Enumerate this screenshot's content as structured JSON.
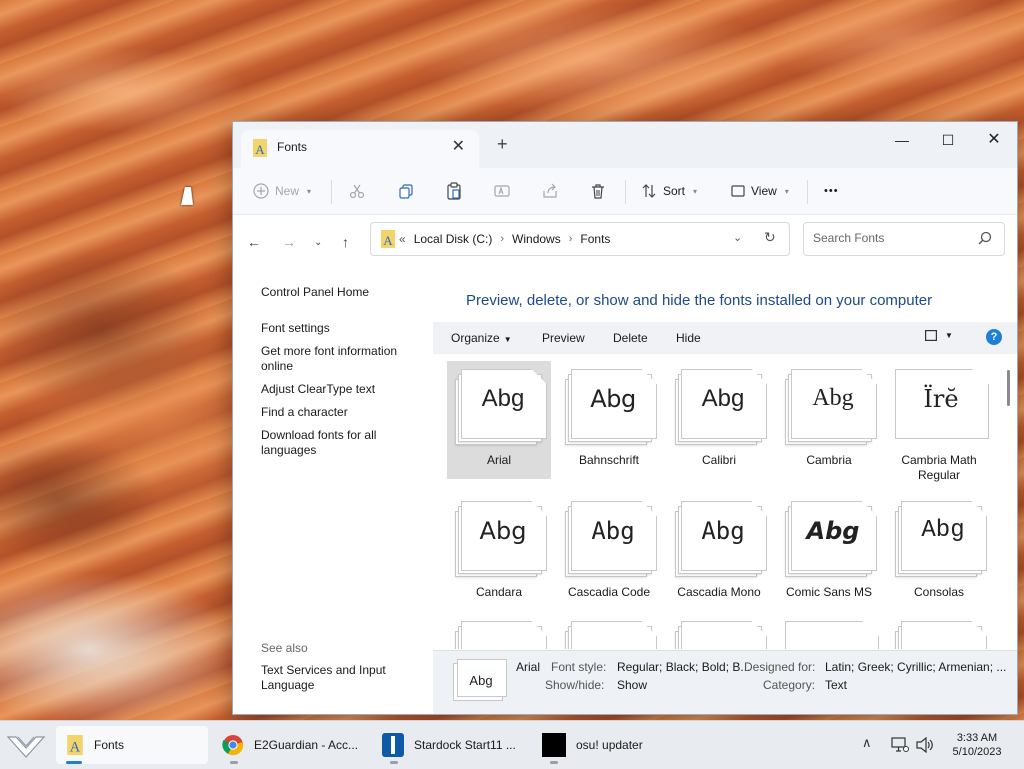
{
  "window": {
    "tab_title": "Fonts",
    "min_glyph": "—",
    "max_glyph": "☐",
    "close_glyph": "✕",
    "tab_close_glyph": "✕",
    "new_tab_glyph": "+"
  },
  "commandbar": {
    "new_label": "New",
    "sort_label": "Sort",
    "view_label": "View",
    "more_glyph": "•••"
  },
  "address": {
    "overflow": "«",
    "crumbs": [
      "Local Disk (C:)",
      "Windows",
      "Fonts"
    ],
    "sep": "›",
    "search_placeholder": "Search Fonts"
  },
  "leftpane": {
    "links": [
      "Control Panel Home",
      "Font settings",
      "Get more font information online",
      "Adjust ClearType text",
      "Find a character",
      "Download fonts for all languages"
    ],
    "see_also_label": "See also",
    "see_also_links": [
      "Text Services and Input Language"
    ]
  },
  "main": {
    "title": "Preview, delete, or show and hide the fonts installed on your computer",
    "toolbar": {
      "organize": "Organize",
      "preview": "Preview",
      "delete": "Delete",
      "hide": "Hide",
      "help": "?"
    },
    "fonts": [
      {
        "name": "Arial",
        "sample": "Abg",
        "selected": true
      },
      {
        "name": "Bahnschrift",
        "sample": "Abg"
      },
      {
        "name": "Calibri",
        "sample": "Abg"
      },
      {
        "name": "Cambria",
        "sample": "Abg"
      },
      {
        "name": "Cambria Math Regular",
        "sample": "Ïrĕ"
      },
      {
        "name": "Candara",
        "sample": "Abg"
      },
      {
        "name": "Cascadia Code",
        "sample": "Abg"
      },
      {
        "name": "Cascadia Mono",
        "sample": "Abg"
      },
      {
        "name": "Comic Sans MS",
        "sample": "Abg"
      },
      {
        "name": "Consolas",
        "sample": "Abg"
      }
    ]
  },
  "details": {
    "sample": "Abg",
    "name": "Arial",
    "font_style_label": "Font style:",
    "font_style_value": "Regular; Black; Bold; B...",
    "show_hide_label": "Show/hide:",
    "show_hide_value": "Show",
    "designed_for_label": "Designed for:",
    "designed_for_value": "Latin; Greek; Cyrillic; Armenian; ...",
    "category_label": "Category:",
    "category_value": "Text"
  },
  "taskbar": {
    "apps": [
      {
        "label": "Fonts"
      },
      {
        "label": "E2Guardian - Acc..."
      },
      {
        "label": "Stardock Start11 ..."
      },
      {
        "label": "osu! updater"
      }
    ],
    "time": "3:33 AM",
    "date": "5/10/2023",
    "tray_chevron": "∧"
  }
}
